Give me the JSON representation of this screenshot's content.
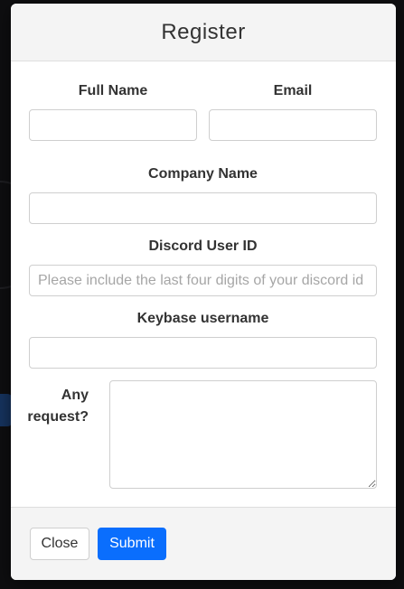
{
  "modal": {
    "title": "Register"
  },
  "form": {
    "full_name": {
      "label": "Full Name",
      "value": "",
      "placeholder": ""
    },
    "email": {
      "label": "Email",
      "value": "",
      "placeholder": ""
    },
    "company_name": {
      "label": "Company Name",
      "value": "",
      "placeholder": ""
    },
    "discord_user_id": {
      "label": "Discord User ID",
      "value": "",
      "placeholder": "Please include the last four digits of your discord id"
    },
    "keybase_username": {
      "label": "Keybase username",
      "value": "",
      "placeholder": ""
    },
    "any_request": {
      "label_line1": "Any",
      "label_line2": "request?",
      "value": ""
    }
  },
  "footer": {
    "close_label": "Close",
    "submit_label": "Submit"
  },
  "colors": {
    "primary": "#0a6efd",
    "header_bg": "#f4f4f4"
  }
}
